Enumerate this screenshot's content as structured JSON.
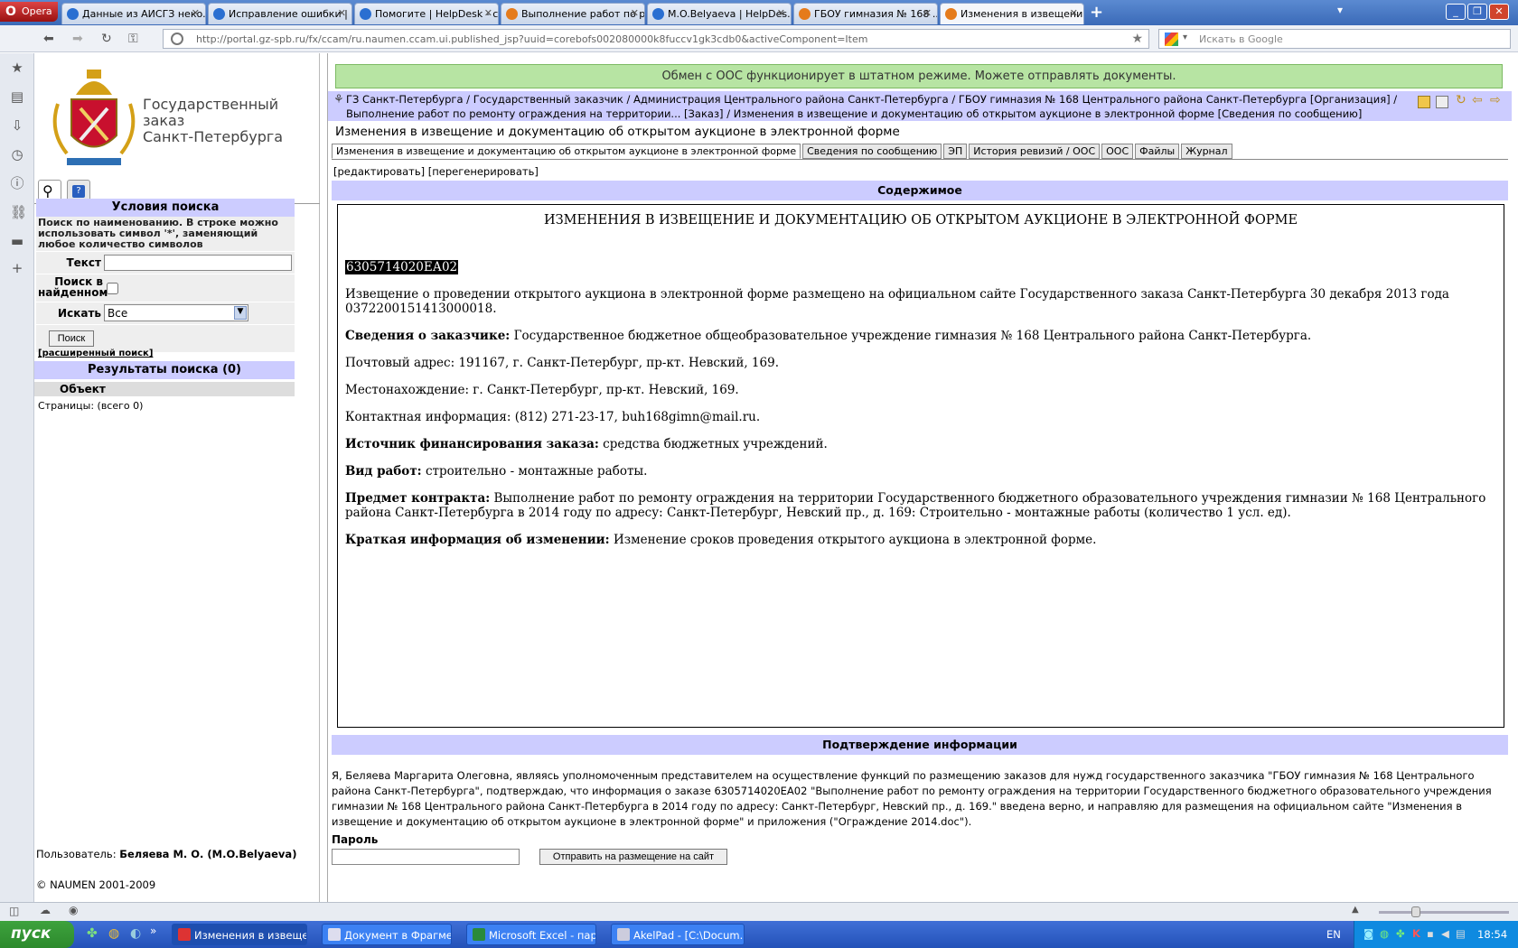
{
  "browser": {
    "menu_label": "Opera",
    "tabs": [
      {
        "label": "Данные из АИСГЗ неко...",
        "icon": "opera-page-icon"
      },
      {
        "label": "Исправление ошибки | Н...",
        "icon": "opera-page-icon"
      },
      {
        "label": "Помогите | HelpDesk - с...",
        "icon": "opera-page-icon"
      },
      {
        "label": "Выполнение работ по р...",
        "icon": "naumen-icon"
      },
      {
        "label": "M.O.Belyaeva | HelpDes...",
        "icon": "opera-page-icon"
      },
      {
        "label": "ГБОУ гимназия № 168 ...",
        "icon": "naumen-icon"
      },
      {
        "label": "Изменения в извещени...",
        "icon": "naumen-icon"
      }
    ],
    "address": "http://portal.gz-spb.ru/fx/ccam/ru.naumen.ccam.ui.published_jsp?uuid=corebofs002080000k8fuccv1gk3cdb0&activeComponent=Item",
    "search_placeholder": "Искать в Google"
  },
  "logo": {
    "line1": "Государственный",
    "line2": "заказ",
    "line3": "Санкт-Петербурга"
  },
  "search": {
    "header": "Условия поиска",
    "hint": "Поиск по наименованию. В строке можно использовать символ '*', заменяющий любое количество символов",
    "text_label": "Текст",
    "text_value": "",
    "in_found_label": "Поиск в найденном",
    "search_in_label": "Искать",
    "search_in_value": "Все",
    "button": "Поиск",
    "advanced": "[расширенный поиск]",
    "results_header": "Результаты поиска (0)",
    "object_col": "Объект",
    "pages": "Страницы:  (всего 0)"
  },
  "user": {
    "label": "Пользователь:",
    "name": "Беляева М. О. (M.O.Belyaeva)"
  },
  "copyright": "© NAUMEN 2001-2009",
  "main": {
    "ooc_status": "Обмен с ООС функционирует в штатном режиме. Можете отправлять документы.",
    "breadcrumb": "ГЗ Санкт-Петербурга / Государственный заказчик / Администрация Центрального района Санкт-Петербурга / ГБОУ гимназия № 168 Центрального района Санкт-Петербурга [Организация] / Выполнение работ по ремонту ограждения на территории... [Заказ] / Изменения в извещение и документацию об открытом аукционе в электронной форме [Сведения по сообщению]",
    "page_title": "Изменения в извещение и документацию об открытом аукционе в электронной форме",
    "tabs": [
      "Изменения в извещение и документацию об открытом аукционе в электронной форме",
      "Сведения по сообщению",
      "ЭП",
      "История ревизий / ООС",
      "ООС",
      "Файлы",
      "Журнал"
    ],
    "edit_link": "[редактировать]",
    "regen_link": "[перегенерировать]",
    "content_header": "Содержимое",
    "confirm_header": "Подтверждение информации",
    "password_label": "Пароль",
    "password_value": "",
    "submit_button": "Отправить на размещение на сайт",
    "confirm_text": "Я, Беляева Маргарита Олеговна, являясь уполномоченным представителем на осуществление функций по размещению заказов для нужд государственного заказчика \"ГБОУ гимназия № 168 Центрального района Санкт-Петербурга\", подтверждаю, что информация о заказе 6305714020ЕА02 \"Выполнение работ по ремонту ограждения на территории Государственного бюджетного образовательного учреждения гимназии № 168 Центрального района Санкт-Петербурга в 2014 году по адресу: Санкт-Петербург, Невский пр., д. 169.\" введена верно, и направляю для размещения на официальном сайте \"Изменения в извещение и документацию об открытом аукционе в электронной форме\" и приложения (\"Ограждение 2014.doc\")."
  },
  "document": {
    "title": "ИЗМЕНЕНИЯ В ИЗВЕЩЕНИЕ И ДОКУМЕНТАЦИЮ ОБ ОТКРЫТОМ АУКЦИОНЕ В ЭЛЕКТРОННОЙ ФОРМЕ",
    "code": "6305714020ЕА02",
    "notice": "Извещение о проведении открытого аукциона в электронной форме размещено на официальном сайте Государственного заказа Санкт-Петербурга 30 декабря 2013 года 0372200151413000018.",
    "customer_label": "Сведения о заказчике:",
    "customer": "Государственное бюджетное общеобразовательное учреждение гимназия № 168 Центрального района Санкт-Петербурга.",
    "postal": "Почтовый адрес: 191167, г. Санкт-Петербург, пр-кт. Невский, 169.",
    "location": "Местонахождение: г. Санкт-Петербург, пр-кт. Невский, 169.",
    "contacts": "Контактная информация: (812) 271-23-17, buh168gimn@mail.ru.",
    "funding_label": "Источник финансирования заказа:",
    "funding": "средства бюджетных учреждений.",
    "work_label": "Вид работ:",
    "work": "строительно - монтажные работы.",
    "subject_label": "Предмет контракта:",
    "subject": "Выполнение работ по ремонту ограждения на территории Государственного бюджетного образовательного учреждения гимназии № 168 Центрального района Санкт-Петербурга в 2014 году по адресу: Санкт-Петербург, Невский пр., д. 169: Строительно - монтажные работы (количество 1 усл. ед).",
    "change_label": "Краткая информация об изменении:",
    "change": "Изменение сроков проведения открытого аукциона в электронной форме."
  },
  "taskbar": {
    "start": "пуск",
    "tasks": [
      {
        "label": "Изменения в извеще..."
      },
      {
        "label": "Документ в Фрагме..."
      },
      {
        "label": "Microsoft Excel - пар..."
      },
      {
        "label": "AkelPad - [C:\\Docum..."
      }
    ],
    "lang": "EN",
    "clock": "18:54"
  },
  "colors": {
    "accent_header": "#ccccff",
    "ooc_green": "#b7e4a3",
    "brand_red": "#c8102e"
  }
}
